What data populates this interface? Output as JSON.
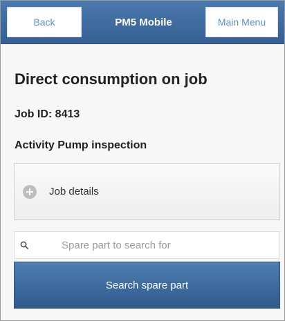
{
  "header": {
    "back_label": "Back",
    "title": "PM5 Mobile",
    "menu_label": "Main Menu"
  },
  "page": {
    "title": "Direct consumption on job",
    "job_id": "Job ID: 8413",
    "activity": "Activity Pump inspection"
  },
  "job_details": {
    "label": "Job details",
    "icon": "plus-circle-icon"
  },
  "search": {
    "placeholder": "Spare part to search for",
    "value": "",
    "icon": "search-icon"
  },
  "search_button": {
    "label": "Search spare part"
  },
  "colors": {
    "header_bg": "#4a79ad",
    "button_bg": "#3c689b",
    "link_text": "#5a8ed0"
  }
}
